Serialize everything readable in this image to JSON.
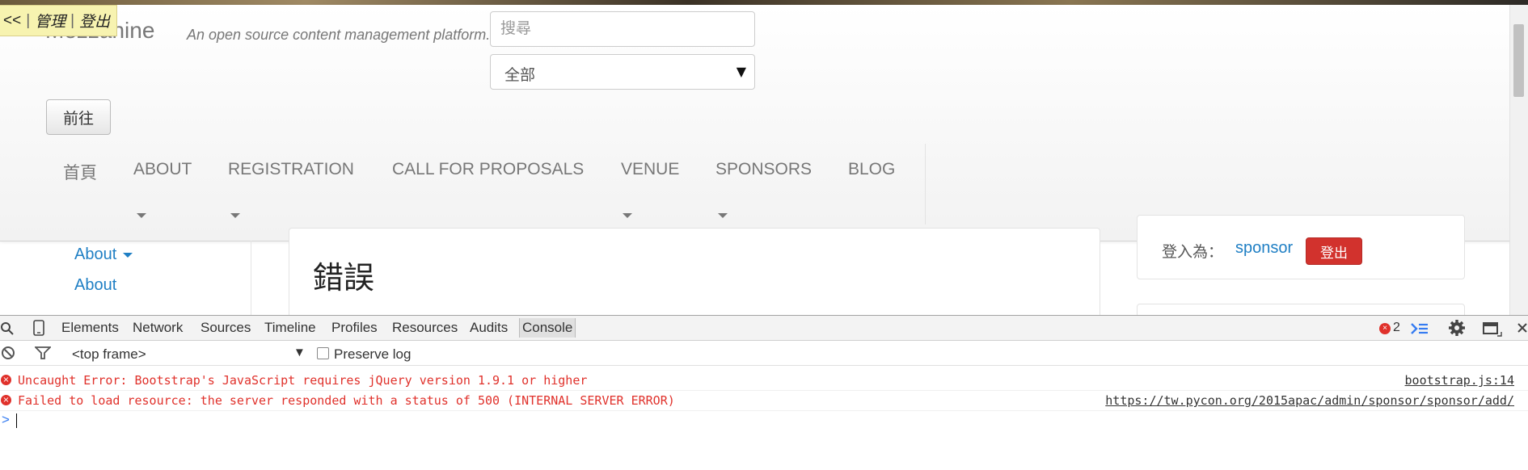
{
  "site": {
    "admin_bar": {
      "back": "<<",
      "manage": "管理",
      "logout": "登出"
    },
    "brand": "Mezzanine",
    "tagline": "An open source content management platform.",
    "search": {
      "placeholder": "搜尋",
      "scope": "全部",
      "go_label": "前往"
    },
    "nav": [
      {
        "label": "首頁",
        "has_dropdown": false
      },
      {
        "label": "ABOUT",
        "has_dropdown": true
      },
      {
        "label": "REGISTRATION",
        "has_dropdown": true
      },
      {
        "label": "CALL FOR PROPOSALS",
        "has_dropdown": false
      },
      {
        "label": "VENUE",
        "has_dropdown": true
      },
      {
        "label": "SPONSORS",
        "has_dropdown": true
      },
      {
        "label": "BLOG",
        "has_dropdown": false
      }
    ],
    "sidebar": {
      "section": "About",
      "link": "About"
    },
    "error_title": "錯誤",
    "login": {
      "label": "登入為：",
      "user": "sponsor",
      "logout_label": "登出"
    }
  },
  "devtools": {
    "tabs": [
      "Elements",
      "Network",
      "Sources",
      "Timeline",
      "Profiles",
      "Resources",
      "Audits",
      "Console"
    ],
    "active_tab": "Console",
    "error_count": "2",
    "frame": "<top frame>",
    "preserve_log": "Preserve log",
    "messages": [
      {
        "level": "error",
        "text": "Uncaught Error: Bootstrap's JavaScript requires jQuery version 1.9.1 or higher",
        "source": "bootstrap.js:14"
      },
      {
        "level": "error",
        "text": "Failed to load resource: the server responded with a status of 500 (INTERNAL SERVER ERROR)",
        "source": "https://tw.pycon.org/2015apac/admin/sponsor/sponsor/add/"
      }
    ],
    "prompt": ">"
  },
  "colors": {
    "link": "#1f7fc4",
    "error": "#e0312b",
    "danger_button": "#d2322d",
    "admin_bar": "#f7f3b0"
  }
}
